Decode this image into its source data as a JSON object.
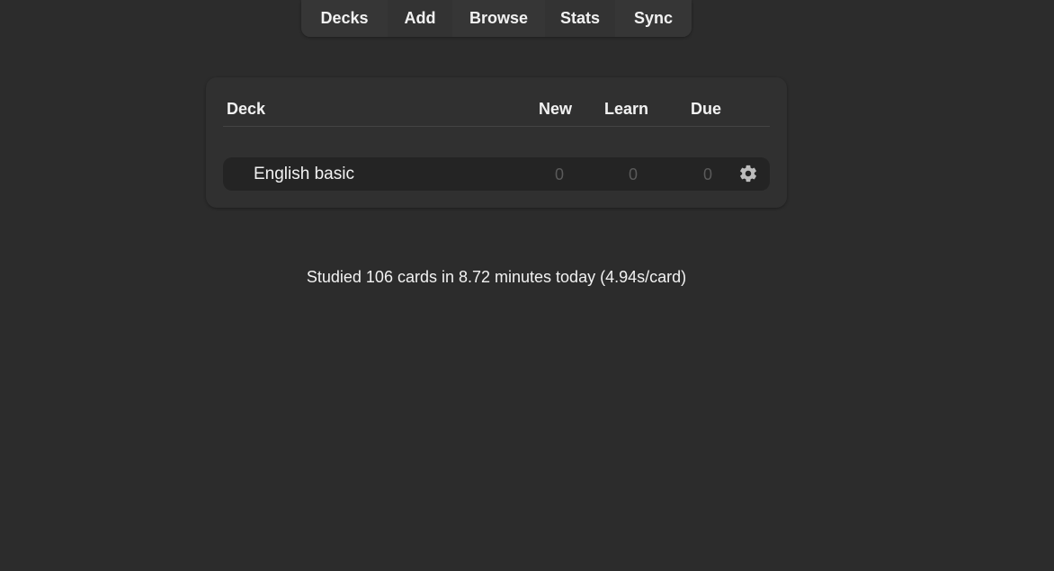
{
  "toolbar": {
    "items": [
      {
        "label": "Decks"
      },
      {
        "label": "Add"
      },
      {
        "label": "Browse"
      },
      {
        "label": "Stats"
      },
      {
        "label": "Sync"
      }
    ]
  },
  "deck_table": {
    "headers": {
      "deck": "Deck",
      "new": "New",
      "learn": "Learn",
      "due": "Due"
    },
    "rows": [
      {
        "name": "English basic",
        "new": "0",
        "learn": "0",
        "due": "0",
        "options_icon": "gear-icon"
      }
    ]
  },
  "summary": {
    "text": "Studied 106 cards in 8.72 minutes today (4.94s/card)"
  },
  "colors": {
    "background": "#2c2c2c",
    "panel": "#303030",
    "row": "#242424",
    "text": "#f2f2f2",
    "muted_count": "#5a5a5a",
    "icon": "#bdbdbd"
  }
}
